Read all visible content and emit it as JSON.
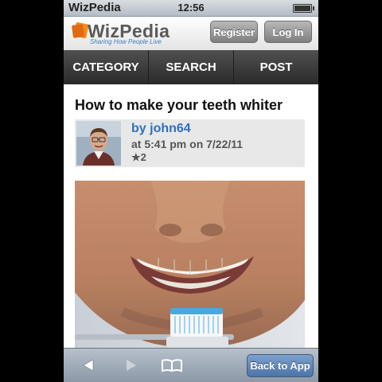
{
  "status_bar": {
    "carrier": "WizPedia",
    "time": "12:56"
  },
  "header": {
    "logo_text": "WizPedia",
    "tagline": "Sharing How People Live",
    "register_label": "Register",
    "login_label": "Log In"
  },
  "nav": {
    "tabs": [
      "CATEGORY",
      "SEARCH",
      "POST"
    ]
  },
  "article": {
    "title": "How to make your teeth whiter",
    "author": "by john64",
    "posted": "at 5:41 pm on 7/22/11",
    "rating": "★2"
  },
  "toolbar": {
    "back_icon": "back-arrow-icon",
    "forward_icon": "forward-arrow-icon",
    "bookmarks_icon": "bookmarks-icon",
    "back_to_app_label": "Back to App"
  },
  "colors": {
    "brand_blue": "#2f6fbf",
    "nav_bg": "#3a3a3a",
    "button_blue": "#5a80b4"
  }
}
